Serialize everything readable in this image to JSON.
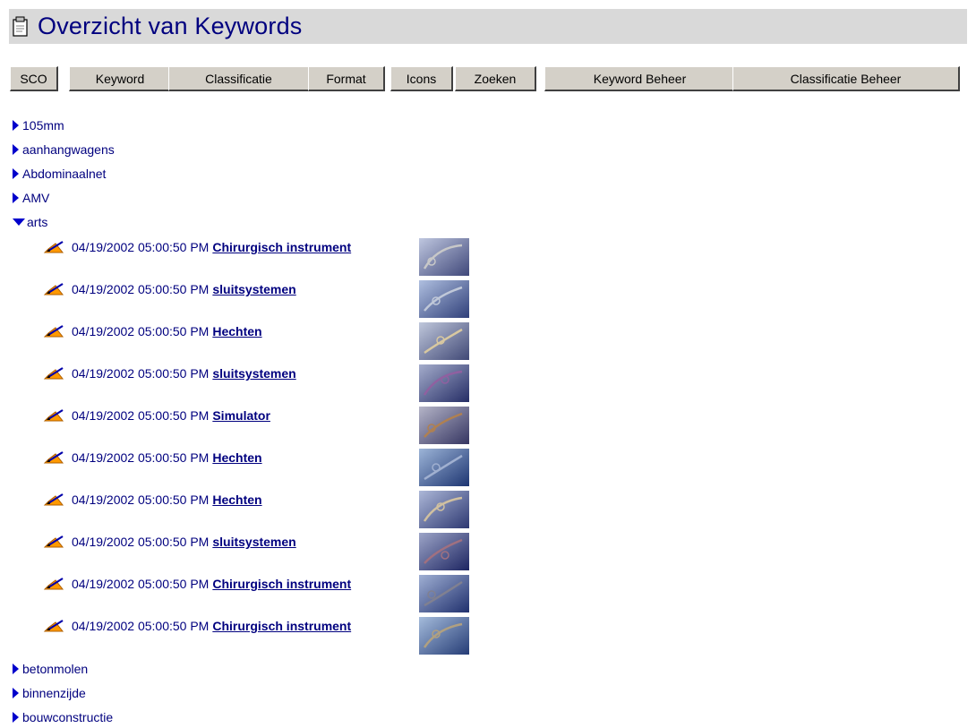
{
  "title": "Overzicht van Keywords",
  "icons": {
    "title": "document-icon",
    "edit": "pencil-edit-icon",
    "collapsed": "triangle-right-icon",
    "expanded": "triangle-down-icon"
  },
  "colors": {
    "link": "#00007f",
    "triangle": "#0000cc",
    "title_bar": "#d9d9d9",
    "button_face": "#d4d0c8",
    "edit_icon": "#ff9900"
  },
  "toolbar": [
    {
      "label": "SCO"
    },
    {
      "label": "Keyword"
    },
    {
      "label": "Classificatie"
    },
    {
      "label": "Format"
    },
    {
      "label": "Icons"
    },
    {
      "label": "Zoeken"
    },
    {
      "label": "Keyword Beheer"
    },
    {
      "label": "Classificatie Beheer"
    }
  ],
  "tree_top": [
    {
      "label": "105mm",
      "expanded": false
    },
    {
      "label": "aanhangwagens",
      "expanded": false
    },
    {
      "label": "Abdominaalnet",
      "expanded": false
    },
    {
      "label": "AMV",
      "expanded": false
    },
    {
      "label": "arts",
      "expanded": true
    }
  ],
  "entries": [
    {
      "timestamp": "04/19/2002 05:00:50 PM",
      "link": "Chirurgisch instrument"
    },
    {
      "timestamp": "04/19/2002 05:00:50 PM",
      "link": "sluitsystemen"
    },
    {
      "timestamp": "04/19/2002 05:00:50 PM",
      "link": "Hechten"
    },
    {
      "timestamp": "04/19/2002 05:00:50 PM",
      "link": "sluitsystemen"
    },
    {
      "timestamp": "04/19/2002 05:00:50 PM",
      "link": "Simulator"
    },
    {
      "timestamp": "04/19/2002 05:00:50 PM",
      "link": "Hechten"
    },
    {
      "timestamp": "04/19/2002 05:00:50 PM",
      "link": "Hechten"
    },
    {
      "timestamp": "04/19/2002 05:00:50 PM",
      "link": "sluitsystemen"
    },
    {
      "timestamp": "04/19/2002 05:00:50 PM",
      "link": "Chirurgisch instrument"
    },
    {
      "timestamp": "04/19/2002 05:00:50 PM",
      "link": "Chirurgisch instrument"
    }
  ],
  "tree_bottom": [
    {
      "label": "betonmolen",
      "expanded": false
    },
    {
      "label": "binnenzijde",
      "expanded": false
    },
    {
      "label": "bouwconstructie",
      "expanded": false
    }
  ]
}
